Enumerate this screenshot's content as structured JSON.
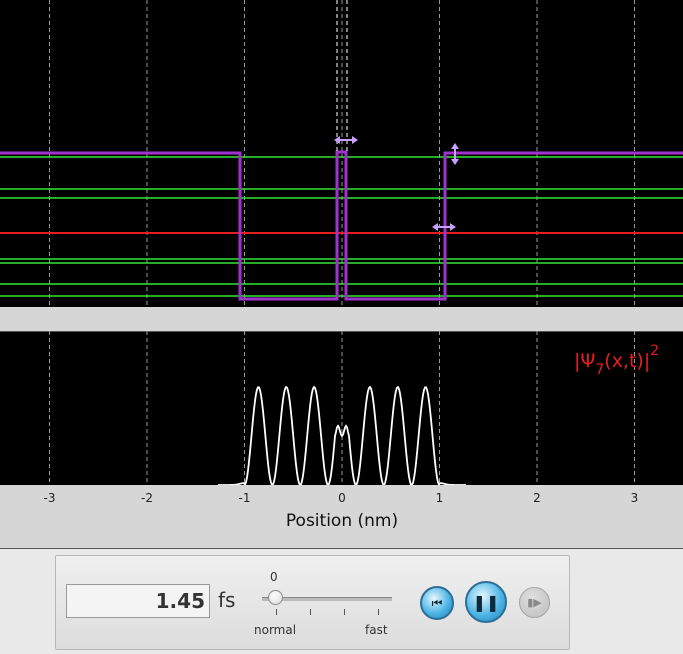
{
  "energy_plot": {
    "colors": {
      "background": "#000000",
      "potential": "#a232d0",
      "energy_level": "#32e632",
      "selected_level": "#e61e1e",
      "handle": "#c8a0ff"
    },
    "selected_level_index": 6
  },
  "wave_plot": {
    "label_symbol": "|Ψ",
    "label_sub": "7",
    "label_args": "(x,t)|",
    "label_sup": "2",
    "colors": {
      "background": "#000000",
      "curve": "#ffffff",
      "label": "#e61e1e"
    }
  },
  "x_axis": {
    "title": "Position (nm)",
    "ticks": [
      "-3",
      "-2",
      "-1",
      "0",
      "1",
      "2",
      "3"
    ],
    "tick_values": [
      -3,
      -2,
      -1,
      0,
      1,
      2,
      3
    ]
  },
  "clock": {
    "time_value": "1.45",
    "time_unit": "fs"
  },
  "speed": {
    "value": "0",
    "min_label": "normal",
    "max_label": "fast",
    "level": 0.0
  },
  "controls": {
    "rewind_icon": "rewind-icon",
    "pause_icon": "pause-icon",
    "step_icon": "step-icon",
    "rewind_glyph": "⏮",
    "pause_glyph": "❚❚",
    "step_glyph": "▮▶"
  }
}
